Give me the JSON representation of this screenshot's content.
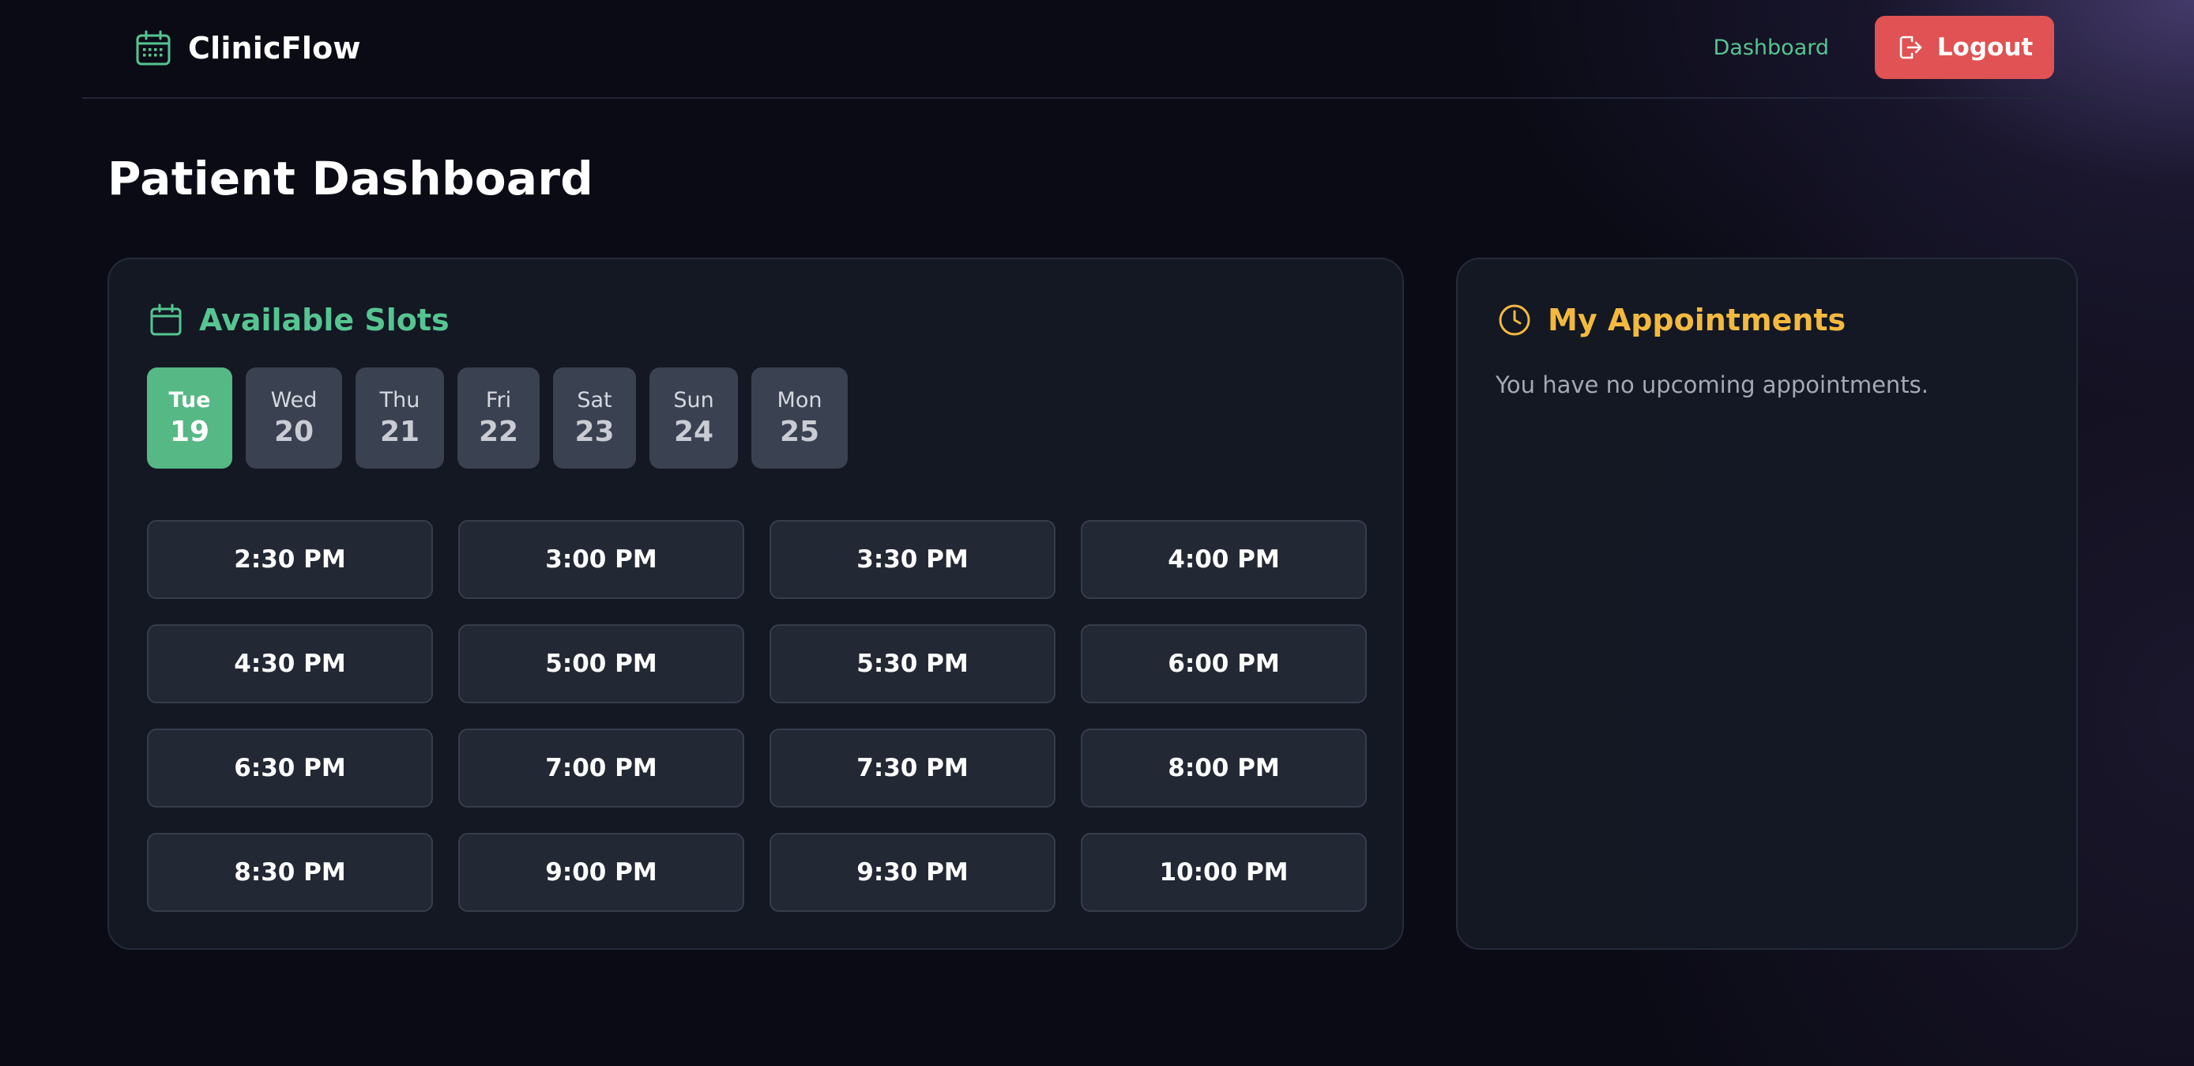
{
  "brand": {
    "name": "ClinicFlow",
    "icon": "calendar-icon",
    "accent": "#56c591"
  },
  "nav": {
    "dashboard_label": "Dashboard",
    "logout_label": "Logout",
    "logout_icon": "logout-icon",
    "logout_color": "#e05253"
  },
  "page": {
    "title": "Patient Dashboard"
  },
  "slots": {
    "title": "Available Slots",
    "icon": "calendar-icon",
    "selected_date_index": 0,
    "dates": [
      {
        "day": "Tue",
        "num": "19"
      },
      {
        "day": "Wed",
        "num": "20"
      },
      {
        "day": "Thu",
        "num": "21"
      },
      {
        "day": "Fri",
        "num": "22"
      },
      {
        "day": "Sat",
        "num": "23"
      },
      {
        "day": "Sun",
        "num": "24"
      },
      {
        "day": "Mon",
        "num": "25"
      }
    ],
    "times": [
      "2:30 PM",
      "3:00 PM",
      "3:30 PM",
      "4:00 PM",
      "4:30 PM",
      "5:00 PM",
      "5:30 PM",
      "6:00 PM",
      "6:30 PM",
      "7:00 PM",
      "7:30 PM",
      "8:00 PM",
      "8:30 PM",
      "9:00 PM",
      "9:30 PM",
      "10:00 PM"
    ]
  },
  "appointments": {
    "title": "My Appointments",
    "icon": "clock-icon",
    "accent": "#f3b93f",
    "empty_message": "You have no upcoming appointments."
  }
}
